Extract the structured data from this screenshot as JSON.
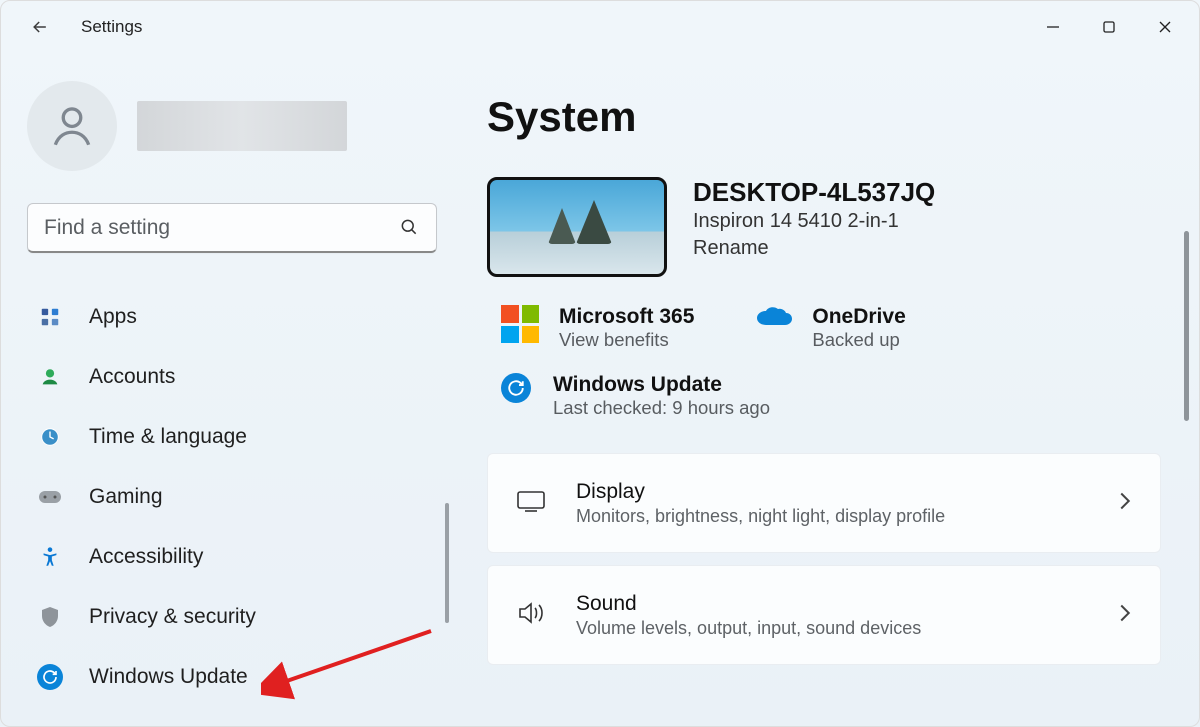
{
  "window": {
    "title": "Settings"
  },
  "search": {
    "placeholder": "Find a setting"
  },
  "nav": {
    "items": [
      {
        "label": "Apps"
      },
      {
        "label": "Accounts"
      },
      {
        "label": "Time & language"
      },
      {
        "label": "Gaming"
      },
      {
        "label": "Accessibility"
      },
      {
        "label": "Privacy & security"
      },
      {
        "label": "Windows Update"
      }
    ]
  },
  "page": {
    "title": "System",
    "device_name": "DESKTOP-4L537JQ",
    "device_model": "Inspiron 14 5410 2-in-1",
    "rename_label": "Rename",
    "info": {
      "ms365_title": "Microsoft 365",
      "ms365_sub": "View benefits",
      "onedrive_title": "OneDrive",
      "onedrive_sub": "Backed up",
      "wu_title": "Windows Update",
      "wu_sub": "Last checked: 9 hours ago"
    },
    "rows": {
      "display_title": "Display",
      "display_sub": "Monitors, brightness, night light, display profile",
      "sound_title": "Sound",
      "sound_sub": "Volume levels, output, input, sound devices"
    }
  }
}
